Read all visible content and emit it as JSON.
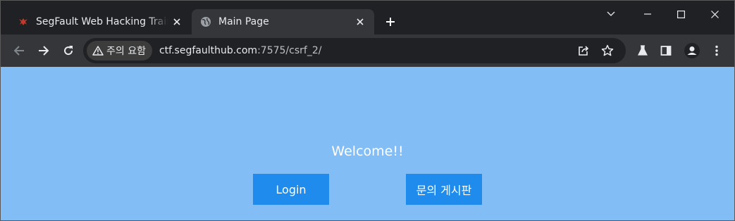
{
  "browser": {
    "tabs": [
      {
        "title": "SegFault Web Hacking Training",
        "active": false,
        "favicon": "segfault-logo-icon"
      },
      {
        "title": "Main Page",
        "active": true,
        "favicon": "globe-icon"
      }
    ],
    "security_chip": "주의 요함",
    "url": {
      "host": "ctf.segfaulthub.com",
      "rest": ":7575/csrf_2/"
    }
  },
  "page": {
    "welcome": "Welcome!!",
    "buttons": {
      "login": "Login",
      "board": "문의 게시판"
    }
  },
  "colors": {
    "page_background": "#82bdf5",
    "button": "#1f8ced",
    "browser_frame": "#202124",
    "toolbar": "#35363a"
  }
}
